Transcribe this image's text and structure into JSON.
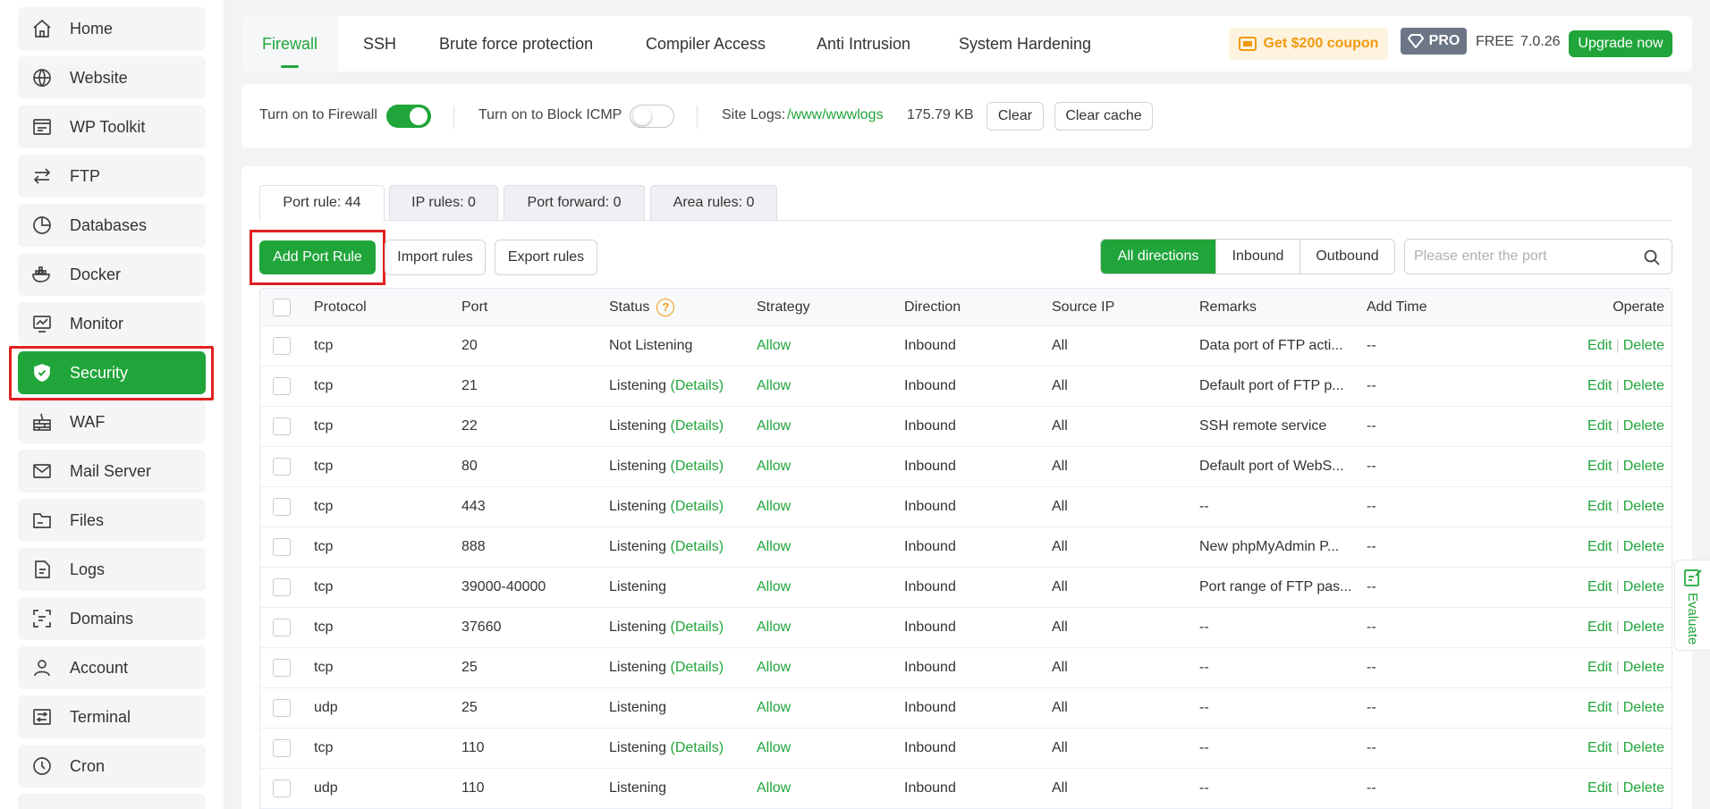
{
  "sidebar": {
    "items": [
      {
        "label": "Home",
        "icon": "home-icon"
      },
      {
        "label": "Website",
        "icon": "globe-icon"
      },
      {
        "label": "WP Toolkit",
        "icon": "wordpress-icon"
      },
      {
        "label": "FTP",
        "icon": "transfer-icon"
      },
      {
        "label": "Databases",
        "icon": "database-icon"
      },
      {
        "label": "Docker",
        "icon": "docker-icon"
      },
      {
        "label": "Monitor",
        "icon": "monitor-icon"
      },
      {
        "label": "Security",
        "icon": "shield-icon",
        "active": true
      },
      {
        "label": "WAF",
        "icon": "firewall-icon"
      },
      {
        "label": "Mail Server",
        "icon": "mail-icon"
      },
      {
        "label": "Files",
        "icon": "folder-icon"
      },
      {
        "label": "Logs",
        "icon": "logs-icon"
      },
      {
        "label": "Domains",
        "icon": "domains-icon"
      },
      {
        "label": "Account",
        "icon": "user-icon"
      },
      {
        "label": "Terminal",
        "icon": "terminal-icon"
      },
      {
        "label": "Cron",
        "icon": "clock-icon"
      }
    ]
  },
  "header": {
    "tabs": [
      "Firewall",
      "SSH",
      "Brute force protection",
      "Compiler Access",
      "Anti Intrusion",
      "System Hardening"
    ],
    "active_tab": "Firewall",
    "coupon": "Get $200 coupon",
    "pro": "PRO",
    "plan": "FREE",
    "version": "7.0.26",
    "upgrade": "Upgrade now"
  },
  "settings": {
    "firewall_label": "Turn on to Firewall",
    "firewall_on": true,
    "icmp_label": "Turn on to Block ICMP",
    "icmp_on": false,
    "site_logs_label": "Site Logs:",
    "site_logs_path": "/www/wwwlogs",
    "log_size": "175.79 KB",
    "clear": "Clear",
    "clear_cache": "Clear cache"
  },
  "subtabs": [
    "Port rule: 44",
    "IP rules: 0",
    "Port forward: 0",
    "Area rules: 0"
  ],
  "toolbar": {
    "add": "Add Port Rule",
    "import": "Import rules",
    "export": "Export rules",
    "directions": [
      "All directions",
      "Inbound",
      "Outbound"
    ],
    "search_placeholder": "Please enter the port"
  },
  "table": {
    "columns": {
      "protocol": "Protocol",
      "port": "Port",
      "status": "Status",
      "strategy": "Strategy",
      "direction": "Direction",
      "source_ip": "Source IP",
      "remarks": "Remarks",
      "add_time": "Add Time",
      "operate": "Operate"
    },
    "help_mark": "?",
    "details_label": "(Details)",
    "edit_label": "Edit",
    "delete_label": "Delete",
    "rows": [
      {
        "protocol": "tcp",
        "port": "20",
        "status": "Not Listening",
        "details": false,
        "strategy": "Allow",
        "direction": "Inbound",
        "source_ip": "All",
        "remarks": "Data port of FTP acti...",
        "add_time": "--"
      },
      {
        "protocol": "tcp",
        "port": "21",
        "status": "Listening",
        "details": true,
        "strategy": "Allow",
        "direction": "Inbound",
        "source_ip": "All",
        "remarks": "Default port of FTP p...",
        "add_time": "--"
      },
      {
        "protocol": "tcp",
        "port": "22",
        "status": "Listening",
        "details": true,
        "strategy": "Allow",
        "direction": "Inbound",
        "source_ip": "All",
        "remarks": "SSH remote service",
        "add_time": "--"
      },
      {
        "protocol": "tcp",
        "port": "80",
        "status": "Listening",
        "details": true,
        "strategy": "Allow",
        "direction": "Inbound",
        "source_ip": "All",
        "remarks": "Default port of WebS...",
        "add_time": "--"
      },
      {
        "protocol": "tcp",
        "port": "443",
        "status": "Listening",
        "details": true,
        "strategy": "Allow",
        "direction": "Inbound",
        "source_ip": "All",
        "remarks": "--",
        "add_time": "--"
      },
      {
        "protocol": "tcp",
        "port": "888",
        "status": "Listening",
        "details": true,
        "strategy": "Allow",
        "direction": "Inbound",
        "source_ip": "All",
        "remarks": "New phpMyAdmin P...",
        "add_time": "--"
      },
      {
        "protocol": "tcp",
        "port": "39000-40000",
        "status": "Listening",
        "details": false,
        "strategy": "Allow",
        "direction": "Inbound",
        "source_ip": "All",
        "remarks": "Port range of FTP pas...",
        "add_time": "--"
      },
      {
        "protocol": "tcp",
        "port": "37660",
        "status": "Listening",
        "details": true,
        "strategy": "Allow",
        "direction": "Inbound",
        "source_ip": "All",
        "remarks": "--",
        "add_time": "--"
      },
      {
        "protocol": "tcp",
        "port": "25",
        "status": "Listening",
        "details": true,
        "strategy": "Allow",
        "direction": "Inbound",
        "source_ip": "All",
        "remarks": "--",
        "add_time": "--"
      },
      {
        "protocol": "udp",
        "port": "25",
        "status": "Listening",
        "details": false,
        "strategy": "Allow",
        "direction": "Inbound",
        "source_ip": "All",
        "remarks": "--",
        "add_time": "--"
      },
      {
        "protocol": "tcp",
        "port": "110",
        "status": "Listening",
        "details": true,
        "strategy": "Allow",
        "direction": "Inbound",
        "source_ip": "All",
        "remarks": "--",
        "add_time": "--"
      },
      {
        "protocol": "udp",
        "port": "110",
        "status": "Listening",
        "details": false,
        "strategy": "Allow",
        "direction": "Inbound",
        "source_ip": "All",
        "remarks": "--",
        "add_time": "--"
      }
    ]
  },
  "side_tab": {
    "label": "Evaluate",
    "icon": "evaluate-icon"
  },
  "colors": {
    "accent": "#20a53a",
    "warning": "#f29a0f",
    "highlight": "#e02020"
  }
}
